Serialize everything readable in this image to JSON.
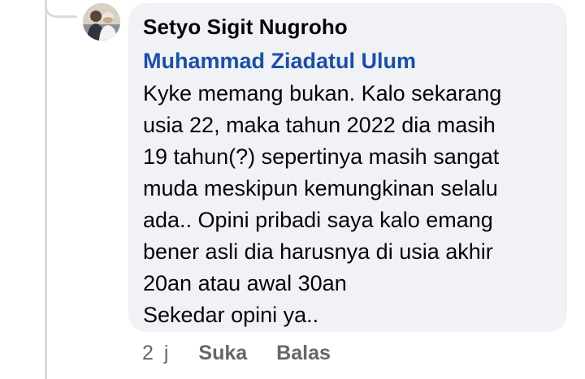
{
  "comment": {
    "author": "Setyo Sigit Nugroho",
    "mention": "Muhammad Ziadatul Ulum",
    "lines": [
      "Kyke memang bukan. Kalo sekarang",
      "usia 22, maka tahun 2022 dia masih",
      "19 tahun(?) sepertinya masih sangat",
      "muda meskipun kemungkinan selalu",
      "ada.. Opini pribadi saya kalo emang",
      "bener asli dia harusnya di usia akhir",
      "20an atau awal 30an",
      "Sekedar opini ya.."
    ],
    "time": "2 j",
    "like_label": "Suka",
    "reply_label": "Balas"
  },
  "colors": {
    "bubble_bg": "#f0f2f5",
    "mention": "#1b4fa6",
    "meta": "#65676b",
    "thread_line": "#d9dbe0"
  },
  "icons": {
    "avatar": "profile-photo"
  }
}
